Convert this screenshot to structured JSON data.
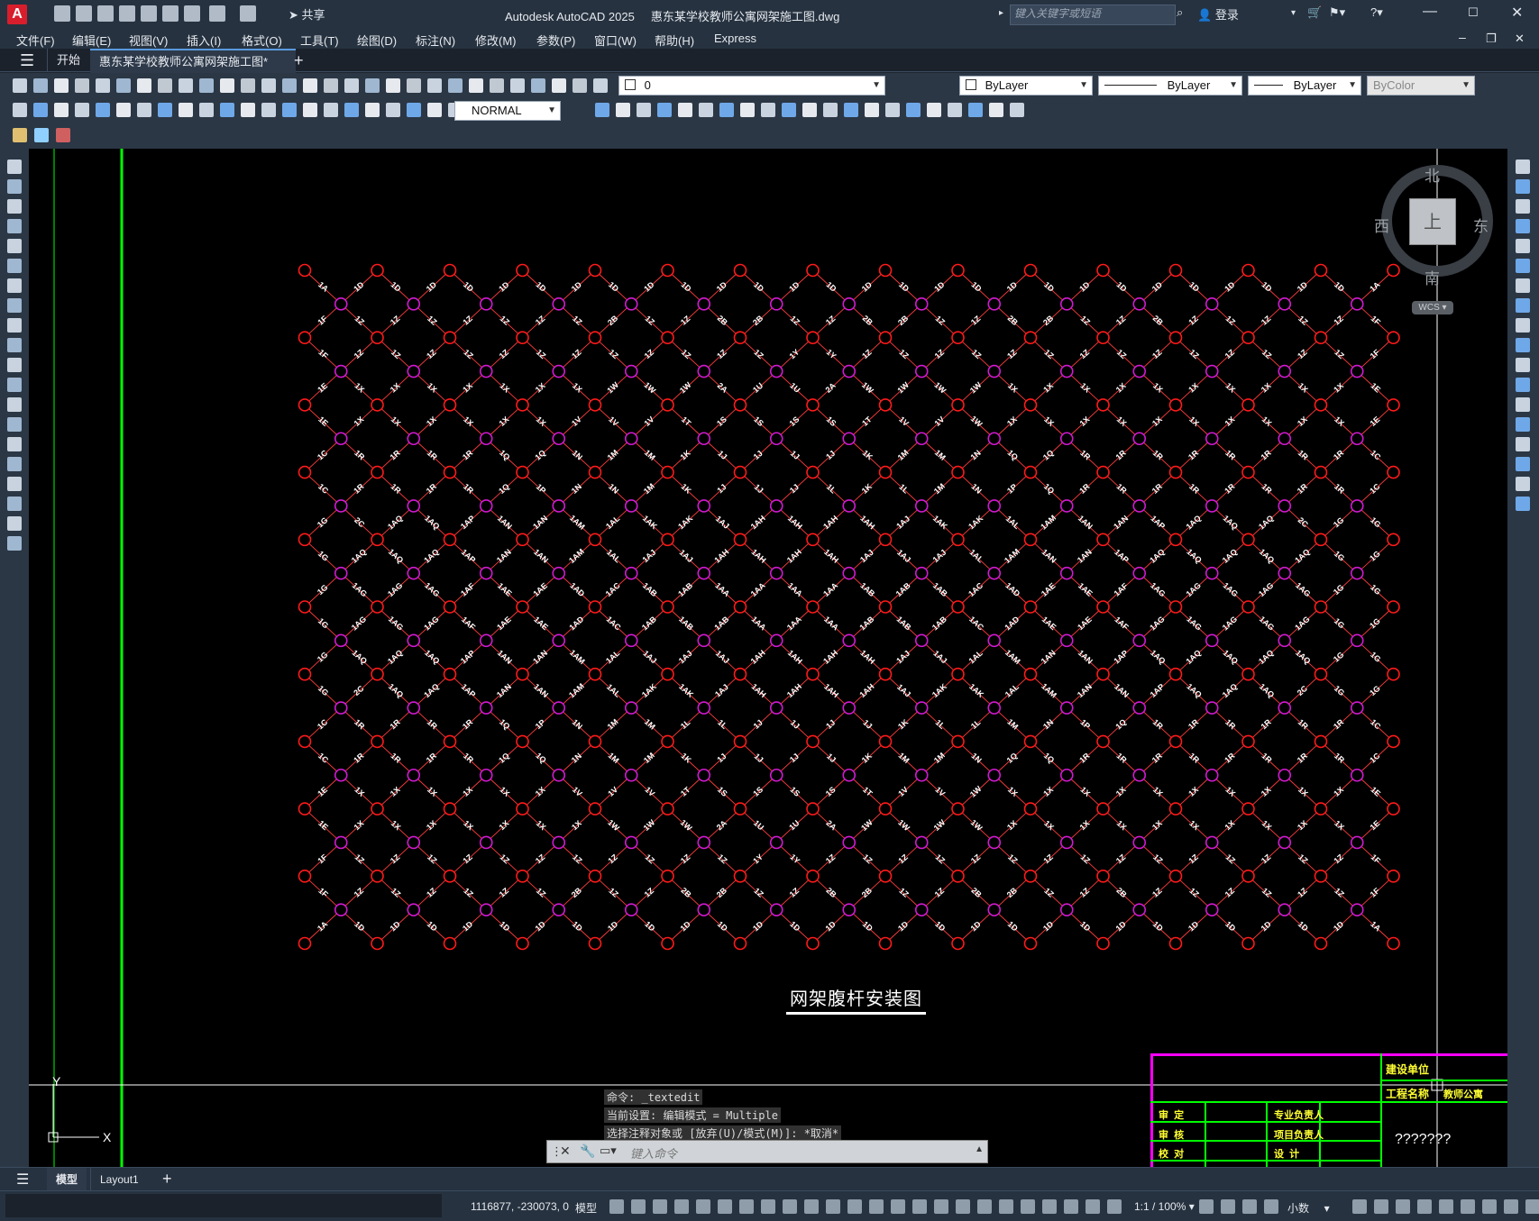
{
  "app": {
    "title": "Autodesk AutoCAD 2025",
    "document": "惠东某学校教师公寓网架施工图.dwg",
    "logo": "A",
    "share": "共享",
    "search_placeholder": "键入关键字或短语",
    "login": "登录"
  },
  "menu": [
    "文件(F)",
    "编辑(E)",
    "视图(V)",
    "插入(I)",
    "格式(O)",
    "工具(T)",
    "绘图(D)",
    "标注(N)",
    "修改(M)",
    "参数(P)",
    "窗口(W)",
    "帮助(H)",
    "Express"
  ],
  "tabs": {
    "start": "开始",
    "active": "惠东某学校教师公寓网架施工图*"
  },
  "properties": {
    "layer": "0",
    "color": "ByLayer",
    "linetype": "ByLayer",
    "lineweight": "ByLayer",
    "plotstyle": "ByColor",
    "textstyle": "NORMAL"
  },
  "viewcube": {
    "north": "北",
    "south": "南",
    "east": "东",
    "west": "西",
    "top": "上",
    "wcs": "WCS"
  },
  "drawing": {
    "title": "网架腹杆安装图",
    "colors": {
      "node_red": "#ff1a1a",
      "node_magenta": "#d21ad2",
      "member": "#ff3d3d",
      "label": "#ffffff",
      "frame": "#00ff00",
      "titleblock": "#ff00ff"
    },
    "row_labels": [
      [
        "1A",
        "1D",
        "1D",
        "1D",
        "1D",
        "1D",
        "1D",
        "1D",
        "1D",
        "1D",
        "1D",
        "1D",
        "1D",
        "1D",
        "1D",
        "1D",
        "1D",
        "1D",
        "1D",
        "1D",
        "1D",
        "1D",
        "1D",
        "1D",
        "1D",
        "1D",
        "1D",
        "1D",
        "1D",
        "1A"
      ],
      [
        "1F",
        "1Z",
        "1Z",
        "1Z",
        "1Z",
        "1Z",
        "1Z",
        "1Z",
        "2B",
        "1Z",
        "1Z",
        "2B",
        "2B",
        "1Z",
        "1Z",
        "2B",
        "2B",
        "1Z",
        "1Z",
        "2B",
        "2B",
        "1Z",
        "1Z",
        "2B",
        "1Z",
        "1Z",
        "1Z",
        "1Z",
        "1Z",
        "1F"
      ],
      [
        "1F",
        "1Z",
        "1Z",
        "1Z",
        "1Z",
        "1Z",
        "1Z",
        "1Z",
        "1Z",
        "1Z",
        "1Z",
        "1Z",
        "1Z",
        "1Y",
        "1Y",
        "1Z",
        "1Z",
        "1Z",
        "1Z",
        "1Z",
        "1Z",
        "1Z",
        "1Z",
        "1Z",
        "1Z",
        "1Z",
        "1Z",
        "1Z",
        "1Z",
        "1F"
      ],
      [
        "1E",
        "1X",
        "1X",
        "1X",
        "1X",
        "1X",
        "1X",
        "1X",
        "1W",
        "1W",
        "1W",
        "2A",
        "1U",
        "1U",
        "2A",
        "1W",
        "1W",
        "1W",
        "1W",
        "1X",
        "1X",
        "1X",
        "1X",
        "1X",
        "1X",
        "1X",
        "1X",
        "1X",
        "1X",
        "1E"
      ],
      [
        "1E",
        "1X",
        "1X",
        "1X",
        "1X",
        "1X",
        "1X",
        "1V",
        "1V",
        "1V",
        "1T",
        "1S",
        "1S",
        "1S",
        "1S",
        "1T",
        "1V",
        "1V",
        "1W",
        "1X",
        "1X",
        "1X",
        "1X",
        "1X",
        "1X",
        "1X",
        "1X",
        "1X",
        "1X",
        "1E"
      ],
      [
        "1C",
        "1R",
        "1R",
        "1R",
        "1R",
        "1Q",
        "1Q",
        "1N",
        "1M",
        "1M",
        "1K",
        "1J",
        "1J",
        "1J",
        "1J",
        "1K",
        "1M",
        "1M",
        "1N",
        "1Q",
        "1Q",
        "1R",
        "1R",
        "1R",
        "1R",
        "1R",
        "1R",
        "1R",
        "1R",
        "1C"
      ],
      [
        "1C",
        "1R",
        "1R",
        "1R",
        "1R",
        "1Q",
        "1P",
        "1N",
        "1N",
        "1M",
        "1K",
        "1J",
        "1J",
        "1J",
        "1L",
        "1K",
        "1L",
        "1M",
        "1N",
        "1P",
        "1Q",
        "1R",
        "1R",
        "1R",
        "1R",
        "1R",
        "1R",
        "1R",
        "1R",
        "1C"
      ],
      [
        "1G",
        "2C",
        "1AQ",
        "1AQ",
        "1AP",
        "1AN",
        "1AN",
        "1AM",
        "1AL",
        "1AK",
        "1AK",
        "1AJ",
        "1AH",
        "1AH",
        "1AH",
        "1AH",
        "1AJ",
        "1AK",
        "1AK",
        "1AL",
        "1AM",
        "1AN",
        "1AN",
        "1AP",
        "1AQ",
        "1AQ",
        "1AQ",
        "2C",
        "1G",
        "1G"
      ],
      [
        "1G",
        "1AQ",
        "1AQ",
        "1AQ",
        "1AP",
        "1AN",
        "1AN",
        "1AM",
        "1AL",
        "1AJ",
        "1AJ",
        "1AH",
        "1AH",
        "1AH",
        "1AH",
        "1AJ",
        "1AJ",
        "1AJ",
        "1AL",
        "1AM",
        "1AN",
        "1AN",
        "1AP",
        "1AQ",
        "1AQ",
        "1AQ",
        "1AQ",
        "1AQ",
        "1G",
        "1G"
      ],
      [
        "1G",
        "1AG",
        "1AG",
        "1AG",
        "1AF",
        "1AE",
        "1AE",
        "1AD",
        "1AC",
        "1AB",
        "1AB",
        "1AA",
        "1AA",
        "1AA",
        "1AA",
        "1AB",
        "1AB",
        "1AB",
        "1AC",
        "1AD",
        "1AE",
        "1AE",
        "1AF",
        "1AG",
        "1AG",
        "1AG",
        "1AG",
        "1AG",
        "1G",
        "1G"
      ],
      [
        "1G",
        "1AG",
        "1AG",
        "1AG",
        "1AF",
        "1AE",
        "1AE",
        "1AD",
        "1AC",
        "1AB",
        "1AB",
        "1AB",
        "1AA",
        "1AA",
        "1AA",
        "1AB",
        "1AB",
        "1AB",
        "1AC",
        "1AD",
        "1AE",
        "1AE",
        "1AF",
        "1AG",
        "1AG",
        "1AG",
        "1AG",
        "1AG",
        "1G",
        "1G"
      ],
      [
        "1G",
        "1AQ",
        "1AQ",
        "1AQ",
        "1AP",
        "1AN",
        "1AN",
        "1AM",
        "1AL",
        "1AJ",
        "1AJ",
        "1AJ",
        "1AH",
        "1AH",
        "1AH",
        "1AH",
        "1AJ",
        "1AJ",
        "1AL",
        "1AM",
        "1AN",
        "1AN",
        "1AP",
        "1AQ",
        "1AQ",
        "1AQ",
        "1AQ",
        "1AQ",
        "1G",
        "1G"
      ],
      [
        "1G",
        "2C",
        "1AQ",
        "1AQ",
        "1AP",
        "1AN",
        "1AN",
        "1AM",
        "1AL",
        "1AK",
        "1AK",
        "1AJ",
        "1AH",
        "1AH",
        "1AH",
        "1AH",
        "1AJ",
        "1AK",
        "1AK",
        "1AL",
        "1AM",
        "1AN",
        "1AN",
        "1AP",
        "1AQ",
        "1AQ",
        "1AQ",
        "2C",
        "1G",
        "1G"
      ],
      [
        "1C",
        "1R",
        "1R",
        "1R",
        "1R",
        "1Q",
        "1P",
        "1N",
        "1M",
        "1M",
        "1L",
        "1L",
        "1J",
        "1J",
        "1J",
        "1J",
        "1K",
        "1L",
        "1L",
        "1M",
        "1N",
        "1P",
        "1Q",
        "1R",
        "1R",
        "1R",
        "1R",
        "1R",
        "1R",
        "1C"
      ],
      [
        "1C",
        "1R",
        "1R",
        "1R",
        "1R",
        "1Q",
        "1Q",
        "1N",
        "1M",
        "1M",
        "1K",
        "1J",
        "1J",
        "1J",
        "1J",
        "1K",
        "1M",
        "1M",
        "1N",
        "1Q",
        "1Q",
        "1R",
        "1R",
        "1R",
        "1R",
        "1R",
        "1R",
        "1R",
        "1R",
        "1C"
      ],
      [
        "1E",
        "1X",
        "1X",
        "1X",
        "1X",
        "1X",
        "1X",
        "1V",
        "1V",
        "1V",
        "1T",
        "1S",
        "1S",
        "1S",
        "1S",
        "1T",
        "1V",
        "1V",
        "1W",
        "1X",
        "1X",
        "1X",
        "1X",
        "1X",
        "1X",
        "1X",
        "1X",
        "1X",
        "1X",
        "1E"
      ],
      [
        "1E",
        "1X",
        "1X",
        "1X",
        "1X",
        "1X",
        "1X",
        "1X",
        "1W",
        "1W",
        "1W",
        "2A",
        "1U",
        "1U",
        "2A",
        "1W",
        "1W",
        "1W",
        "1W",
        "1X",
        "1X",
        "1X",
        "1X",
        "1X",
        "1X",
        "1X",
        "1X",
        "1X",
        "1X",
        "1E"
      ],
      [
        "1F",
        "1Z",
        "1Z",
        "1Z",
        "1Z",
        "1Z",
        "1Z",
        "1Z",
        "1Z",
        "1Z",
        "1Z",
        "1Z",
        "1Y",
        "1Y",
        "1Z",
        "1Z",
        "1Z",
        "1Z",
        "1Z",
        "1Z",
        "1Z",
        "1Z",
        "1Z",
        "1Z",
        "1Z",
        "1Z",
        "1Z",
        "1Z",
        "1Z",
        "1F"
      ],
      [
        "1F",
        "1Z",
        "1Z",
        "1Z",
        "1Z",
        "1Z",
        "1Z",
        "2B",
        "1Z",
        "1Z",
        "2B",
        "2B",
        "1Z",
        "1Z",
        "2B",
        "2B",
        "1Z",
        "1Z",
        "2B",
        "2B",
        "1Z",
        "1Z",
        "2B",
        "1Z",
        "1Z",
        "1Z",
        "1Z",
        "1Z",
        "1Z",
        "1F"
      ],
      [
        "1A",
        "1D",
        "1D",
        "1D",
        "1D",
        "1D",
        "1D",
        "1D",
        "1D",
        "1D",
        "1D",
        "1D",
        "1D",
        "1D",
        "1D",
        "1D",
        "1D",
        "1D",
        "1D",
        "1D",
        "1D",
        "1D",
        "1D",
        "1D",
        "1D",
        "1D",
        "1D",
        "1D",
        "1D",
        "1A"
      ]
    ]
  },
  "titleblock": {
    "client": "建设单位",
    "project_name": "工程名称",
    "project_value": "教师公寓",
    "approve": "审  定",
    "review": "审  核",
    "check": "校  对",
    "prof_lead": "专业负责人",
    "proj_lead": "项目负责人",
    "design": "设  计",
    "unknown": "???????"
  },
  "command": {
    "history": [
      "命令: _textedit",
      "当前设置: 编辑模式 = Multiple",
      "选择注释对象或 [放弃(U)/模式(M)]: *取消*"
    ],
    "placeholder": "键入命令"
  },
  "layouts": {
    "model": "模型",
    "layout1": "Layout1"
  },
  "status": {
    "coords": "1116877, -230073, 0",
    "space": "模型",
    "scale": "1:1 / 100%",
    "units": "小数"
  }
}
